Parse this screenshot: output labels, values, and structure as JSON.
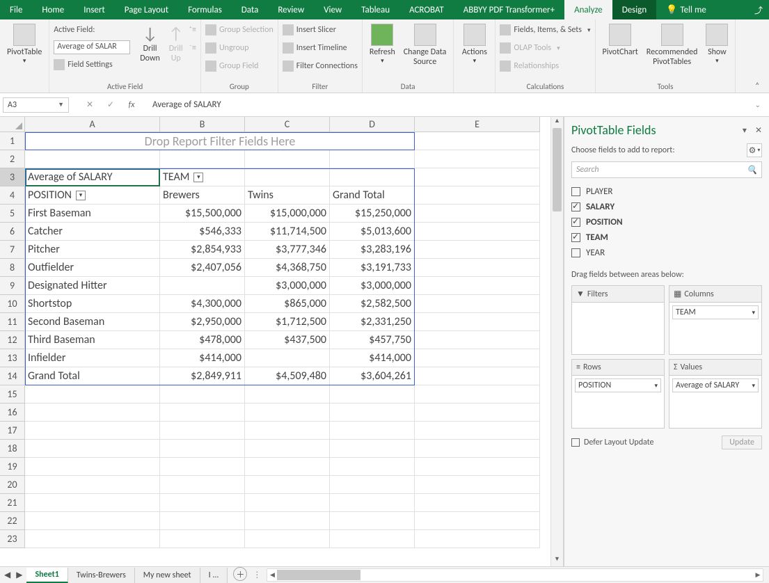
{
  "menubar": {
    "tabs": [
      "File",
      "Home",
      "Insert",
      "Page Layout",
      "Formulas",
      "Data",
      "Review",
      "View",
      "Tableau",
      "ACROBAT",
      "ABBYY PDF Transformer+",
      "Analyze",
      "Design"
    ],
    "tellme": "Tell me"
  },
  "ribbon": {
    "pivotTable": "PivotTable",
    "activeFieldLabel": "Active Field:",
    "activeFieldValue": "Average of SALAR",
    "fieldSettings": "Field Settings",
    "activeFieldGroup": "Active Field",
    "drillDown": "Drill\nDown",
    "drillUp": "Drill\nUp",
    "groupSelection": "Group Selection",
    "ungroup": "Ungroup",
    "groupField": "Group Field",
    "groupLabel": "Group",
    "insertSlicer": "Insert Slicer",
    "insertTimeline": "Insert Timeline",
    "filterConnections": "Filter Connections",
    "filterLabel": "Filter",
    "refresh": "Refresh",
    "changeDataSource": "Change Data\nSource",
    "dataLabel": "Data",
    "actions": "Actions",
    "fieldsItemsSets": "Fields, Items, & Sets",
    "olapTools": "OLAP Tools",
    "relationships": "Relationships",
    "calculationsLabel": "Calculations",
    "pivotChart": "PivotChart",
    "recommended": "Recommended\nPivotTables",
    "show": "Show",
    "toolsLabel": "Tools"
  },
  "namebox": "A3",
  "formula": "Average of SALARY",
  "columns": [
    "A",
    "B",
    "C",
    "D",
    "E"
  ],
  "rows": [
    1,
    2,
    3,
    4,
    5,
    6,
    7,
    8,
    9,
    10,
    11,
    12,
    13,
    14,
    15,
    16,
    17,
    18,
    19,
    20,
    21,
    22,
    23
  ],
  "dropFilterText": "Drop Report Filter Fields Here",
  "pivot": {
    "cornerLabel": "Average of SALARY",
    "colFieldLabel": "TEAM",
    "rowFieldLabel": "POSITION",
    "columnHeaders": [
      "Brewers",
      "Twins",
      "Grand Total"
    ],
    "rows": [
      {
        "label": "First Baseman",
        "values": [
          "$15,500,000",
          "$15,000,000",
          "$15,250,000"
        ]
      },
      {
        "label": "Catcher",
        "values": [
          "$546,333",
          "$11,714,500",
          "$5,013,600"
        ]
      },
      {
        "label": "Pitcher",
        "values": [
          "$2,854,933",
          "$3,777,346",
          "$3,283,196"
        ]
      },
      {
        "label": "Outfielder",
        "values": [
          "$2,407,056",
          "$4,368,750",
          "$3,191,733"
        ]
      },
      {
        "label": "Designated Hitter",
        "values": [
          "",
          "$3,000,000",
          "$3,000,000"
        ]
      },
      {
        "label": "Shortstop",
        "values": [
          "$4,300,000",
          "$865,000",
          "$2,582,500"
        ]
      },
      {
        "label": "Second Baseman",
        "values": [
          "$2,950,000",
          "$1,712,500",
          "$2,331,250"
        ]
      },
      {
        "label": "Third Baseman",
        "values": [
          "$478,000",
          "$437,500",
          "$457,750"
        ]
      },
      {
        "label": "Infielder",
        "values": [
          "$414,000",
          "",
          "$414,000"
        ]
      },
      {
        "label": "Grand Total",
        "values": [
          "$2,849,911",
          "$4,509,480",
          "$3,604,261"
        ]
      }
    ]
  },
  "pane": {
    "title": "PivotTable Fields",
    "subtitle": "Choose fields to add to report:",
    "searchPlaceholder": "Search",
    "fields": [
      {
        "name": "PLAYER",
        "checked": false
      },
      {
        "name": "SALARY",
        "checked": true
      },
      {
        "name": "POSITION",
        "checked": true
      },
      {
        "name": "TEAM",
        "checked": true
      },
      {
        "name": "YEAR",
        "checked": false
      }
    ],
    "dragLabel": "Drag fields between areas below:",
    "filtersLabel": "Filters",
    "columnsLabel": "Columns",
    "rowsLabel": "Rows",
    "valuesLabel": "Values",
    "columnsItem": "TEAM",
    "rowsItem": "POSITION",
    "valuesItem": "Average of SALARY",
    "deferLabel": "Defer Layout Update",
    "updateLabel": "Update"
  },
  "tabs": {
    "names": [
      "Sheet1",
      "Twins-Brewers",
      "My new sheet",
      "I ..."
    ]
  }
}
